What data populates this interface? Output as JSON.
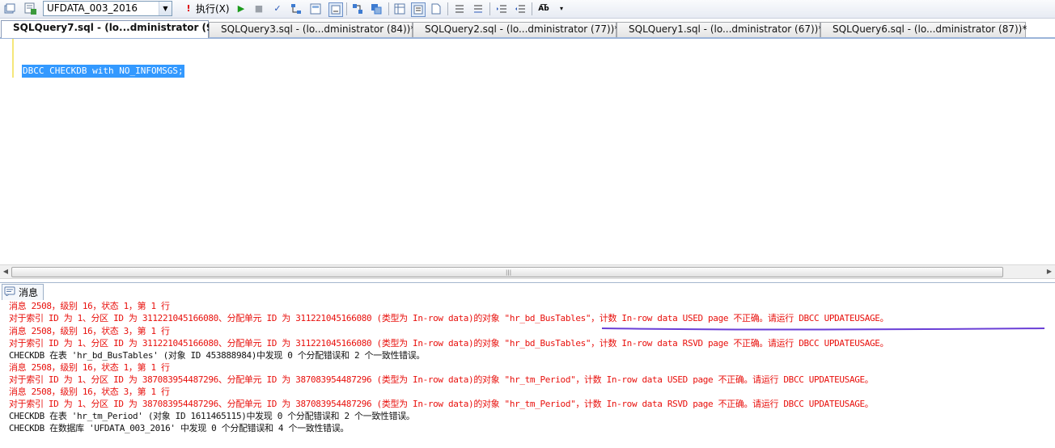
{
  "toolbar": {
    "database": "UFDATA_003_2016",
    "execute_label": "执行(X)",
    "icons": [
      "manage-icon",
      "connect-icon",
      "execute-icon",
      "debug-icon",
      "stop-icon",
      "parse-icon",
      "plan-icon",
      "query-designer-icon",
      "options-icon",
      "grid-icon",
      "text-icon",
      "file-icon",
      "include-plan-icon",
      "client-stats-icon",
      "comment-icon",
      "uncomment-icon",
      "indent-icon",
      "outdent-icon",
      "specify-values-icon"
    ]
  },
  "tabs": [
    {
      "label": "SQLQuery7.sql - (lo...dministrator (90))*",
      "active": true
    },
    {
      "label": "SQLQuery3.sql - (lo...dministrator (84))*",
      "active": false
    },
    {
      "label": "SQLQuery2.sql - (lo...dministrator (77))*",
      "active": false
    },
    {
      "label": "SQLQuery1.sql - (lo...dministrator (67))*",
      "active": false
    },
    {
      "label": "SQLQuery6.sql - (lo...dministrator (87))*",
      "active": false
    }
  ],
  "editor": {
    "sql": "DBCC CHECKDB with NO_INFOMSGS;"
  },
  "messages": {
    "tab_label": "消息",
    "lines": [
      {
        "text": "消息 2508，级别 16，状态 1，第 1 行",
        "color": "#e8100c"
      },
      {
        "text": "对于索引 ID 为 1、分区 ID 为 311221045166080、分配单元 ID 为 311221045166080 (类型为 In-row data)的对象 \"hr_bd_BusTables\"，计数 In-row data USED page 不正确。请运行 DBCC UPDATEUSAGE。",
        "color": "#e8100c"
      },
      {
        "text": "消息 2508，级别 16，状态 3，第 1 行",
        "color": "#e8100c"
      },
      {
        "text": "对于索引 ID 为 1、分区 ID 为 311221045166080、分配单元 ID 为 311221045166080 (类型为 In-row data)的对象 \"hr_bd_BusTables\"，计数 In-row data RSVD page 不正确。请运行 DBCC UPDATEUSAGE。",
        "color": "#e8100c"
      },
      {
        "text": "CHECKDB 在表 'hr_bd_BusTables' (对象 ID 453888984)中发现 0 个分配错误和 2 个一致性错误。",
        "color": "#111111"
      },
      {
        "text": "消息 2508，级别 16，状态 1，第 1 行",
        "color": "#e8100c"
      },
      {
        "text": "对于索引 ID 为 1、分区 ID 为 387083954487296、分配单元 ID 为 387083954487296 (类型为 In-row data)的对象 \"hr_tm_Period\"，计数 In-row data USED page 不正确。请运行 DBCC UPDATEUSAGE。",
        "color": "#e8100c"
      },
      {
        "text": "消息 2508，级别 16，状态 3，第 1 行",
        "color": "#e8100c"
      },
      {
        "text": "对于索引 ID 为 1、分区 ID 为 387083954487296、分配单元 ID 为 387083954487296 (类型为 In-row data)的对象 \"hr_tm_Period\"，计数 In-row data RSVD page 不正确。请运行 DBCC UPDATEUSAGE。",
        "color": "#e8100c"
      },
      {
        "text": "CHECKDB 在表 'hr_tm_Period' (对象 ID 1611465115)中发现 0 个分配错误和 2 个一致性错误。",
        "color": "#111111"
      },
      {
        "text": "CHECKDB 在数据库 'UFDATA_003_2016' 中发现 0 个分配错误和 4 个一致性错误。",
        "color": "#111111"
      }
    ],
    "annotation_color": "#6a3fd6"
  }
}
